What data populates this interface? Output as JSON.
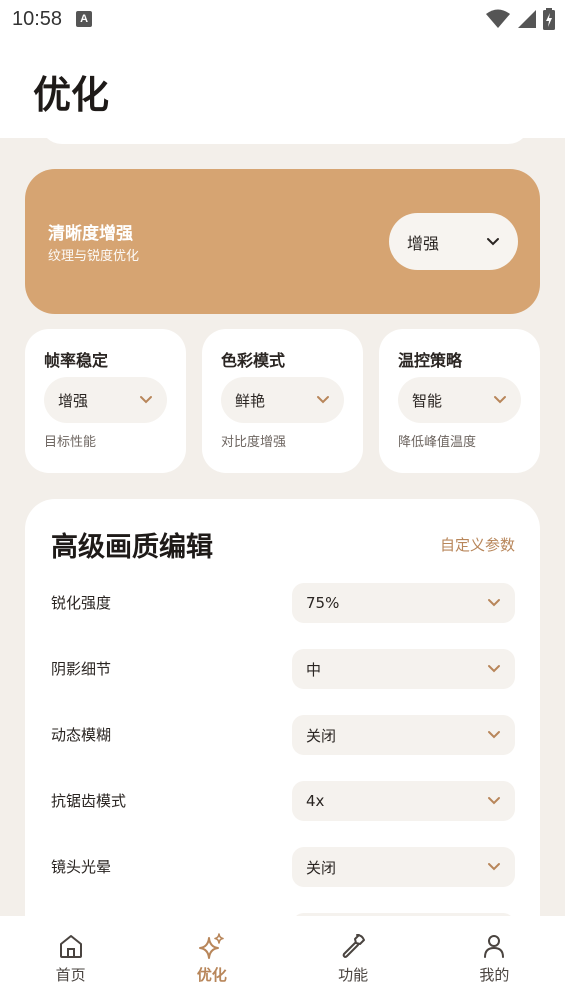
{
  "status_bar": {
    "time": "10:58",
    "notif_icon": "A"
  },
  "header": {
    "title": "优化"
  },
  "hero": {
    "title": "清晰度增强",
    "subtitle": "纹理与锐度优化",
    "select_value": "增强",
    "bg_color": "#d6a472"
  },
  "mini_cards": [
    {
      "title": "帧率稳定",
      "value": "增强",
      "desc": "目标性能"
    },
    {
      "title": "色彩模式",
      "value": "鲜艳",
      "desc": "对比度增强"
    },
    {
      "title": "温控策略",
      "value": "智能",
      "desc": "降低峰值温度"
    }
  ],
  "advanced": {
    "title": "高级画质编辑",
    "link": "自定义参数",
    "rows": [
      {
        "label": "锐化强度",
        "value": "75%"
      },
      {
        "label": "阴影细节",
        "value": "中"
      },
      {
        "label": "动态模糊",
        "value": "关闭"
      },
      {
        "label": "抗锯齿模式",
        "value": "4x"
      },
      {
        "label": "镜头光晕",
        "value": "关闭"
      }
    ]
  },
  "bottom_nav": {
    "items": [
      {
        "label": "首页",
        "icon": "home-icon"
      },
      {
        "label": "优化",
        "icon": "sparkle-icon",
        "active": true
      },
      {
        "label": "功能",
        "icon": "wrench-icon"
      },
      {
        "label": "我的",
        "icon": "person-icon"
      }
    ]
  },
  "colors": {
    "accent": "#b8865a",
    "background": "#f3efea"
  }
}
